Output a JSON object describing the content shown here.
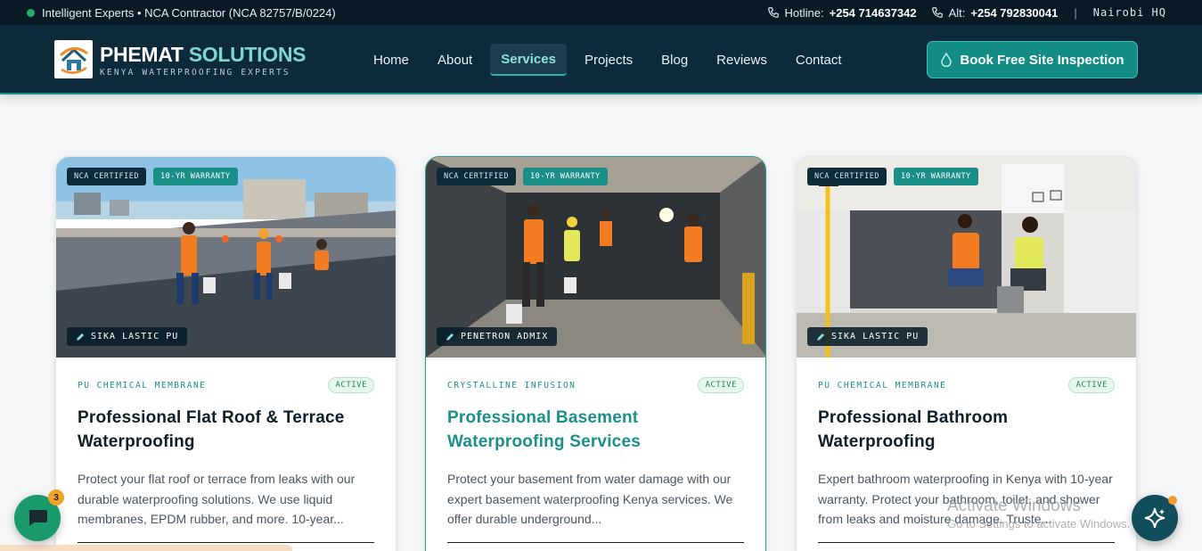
{
  "topbar": {
    "tagline": "Intelligent Experts • NCA Contractor (NCA 82757/B/0224)",
    "hotline_label": "Hotline:",
    "hotline_number": "+254 714637342",
    "alt_label": "Alt:",
    "alt_number": "+254 792830041",
    "separator": "|",
    "location": "Nairobi HQ"
  },
  "brand": {
    "name_part1": "PHEMAT",
    "name_part2": "SOLUTIONS",
    "tagline": "KENYA WATERPROOFING EXPERTS"
  },
  "nav": {
    "items": [
      {
        "label": "Home"
      },
      {
        "label": "About"
      },
      {
        "label": "Services"
      },
      {
        "label": "Projects"
      },
      {
        "label": "Blog"
      },
      {
        "label": "Reviews"
      },
      {
        "label": "Contact"
      }
    ],
    "active": "Services",
    "cta": "Book Free Site Inspection"
  },
  "cards": [
    {
      "badge_certified": "NCA CERTIFIED",
      "badge_warranty": "10-YR WARRANTY",
      "product": "SIKA LASTIC PU",
      "category": "PU CHEMICAL MEMBRANE",
      "status": "ACTIVE",
      "title": "Professional Flat Roof & Terrace Waterproofing",
      "description": "Protect your flat roof or terrace from leaks with our durable waterproofing solutions. We use liquid membranes, EPDM rubber, and more. 10-year..."
    },
    {
      "badge_certified": "NCA CERTIFIED",
      "badge_warranty": "10-YR WARRANTY",
      "product": "PENETRON ADMIX",
      "category": "CRYSTALLINE INFUSION",
      "status": "ACTIVE",
      "title": "Professional Basement Waterproofing Services",
      "description": "Protect your basement from water damage with our expert basement waterproofing Kenya services. We offer durable underground..."
    },
    {
      "badge_certified": "NCA CERTIFIED",
      "badge_warranty": "10-YR WARRANTY",
      "product": "SIKA LASTIC PU",
      "category": "PU CHEMICAL MEMBRANE",
      "status": "ACTIVE",
      "title": "Professional Bathroom Waterproofing",
      "description": "Expert bathroom waterproofing in Kenya with 10-year warranty. Protect your bathroom, toilet, and shower from leaks and moisture damage. Truste..."
    }
  ],
  "chat": {
    "unread": "3"
  },
  "watermark": {
    "line1": "Activate Windows",
    "line2": "Go to Settings to activate Windows."
  },
  "colors": {
    "nav_bg": "#0d2a3a",
    "topbar_bg": "#071a26",
    "accent": "#1a8f88",
    "chat": "#1a9a6a",
    "badge_orange": "#f1a323"
  }
}
